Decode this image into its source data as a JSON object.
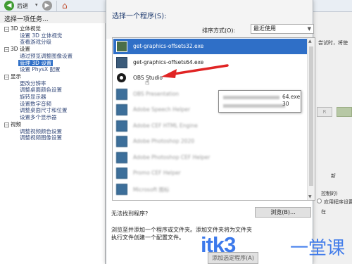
{
  "toolbar": {
    "back_label": "后退",
    "back_dropdown": "▾"
  },
  "task_panel": {
    "title": "选择一项任务...",
    "tree": [
      {
        "type": "cat",
        "label": "3D 立体视觉"
      },
      {
        "type": "sub",
        "label": "设置 3D 立体视觉"
      },
      {
        "type": "sub",
        "label": "查看游戏分级"
      },
      {
        "type": "cat",
        "label": "3D 设置"
      },
      {
        "type": "sub",
        "label": "通过预览调整图像设置"
      },
      {
        "type": "sub",
        "label": "管理 3D 设置",
        "selected": true
      },
      {
        "type": "sub",
        "label": "设置 PhysX 配置"
      },
      {
        "type": "cat",
        "label": "显示"
      },
      {
        "type": "sub",
        "label": "更改分辨率"
      },
      {
        "type": "sub",
        "label": "调整桌面颜色设置"
      },
      {
        "type": "sub",
        "label": "旋转显示器"
      },
      {
        "type": "sub",
        "label": "设置数字音频"
      },
      {
        "type": "sub",
        "label": "调整桌面尺寸和位置"
      },
      {
        "type": "sub",
        "label": "设置多个显示器"
      },
      {
        "type": "cat",
        "label": "视频"
      },
      {
        "type": "sub",
        "label": "调整视频颜色设置"
      },
      {
        "type": "sub",
        "label": "调整视频图像设置"
      }
    ]
  },
  "right_panel": {
    "texts": [
      "尝试时，将使",
      "R",
      "新",
      "控制的)",
      "应用程序设置",
      "在"
    ]
  },
  "dialog": {
    "title": "选择一个程序(S):",
    "sort_label": "排序方式(O):",
    "sort_value": "最近使用",
    "programs": [
      {
        "label": "get-graphics-offsets32.exe",
        "state": "selected"
      },
      {
        "label": "get-graphics-offsets64.exe",
        "state": "normal"
      },
      {
        "label": "OBS Studio",
        "state": "obs"
      },
      {
        "label": "OBS Presentation",
        "state": "blurred"
      },
      {
        "label": "Adobe Speech Helper",
        "state": "blurred"
      },
      {
        "label": "Adobe CEF HTML Engine",
        "state": "blurred"
      },
      {
        "label": "Adobe Photoshop 2020",
        "state": "blurred"
      },
      {
        "label": "Adobe Photoshop CEF Helper",
        "state": "blurred"
      },
      {
        "label": "Promo CEF Helper",
        "state": "blurred"
      },
      {
        "label": "Microsoft 图标",
        "state": "blurred"
      }
    ],
    "tooltip": {
      "exe_suffix": "64.exe",
      "number": "30"
    },
    "not_found": "无法找到程序?",
    "browse_label": "浏览(B)...",
    "desc_line1": "浏览至并添加一个程序或文件夹。添加文件夹将为文件夹",
    "desc_line2": "执行文件创建一个配置文件。",
    "add_label": "添加选定程序(A)"
  },
  "watermark": {
    "text": "itk3",
    "cn": "一堂课",
    "color": "#2c6eea"
  },
  "colors": {
    "selection": "#2f6fc7",
    "arrow": "#e02424"
  }
}
